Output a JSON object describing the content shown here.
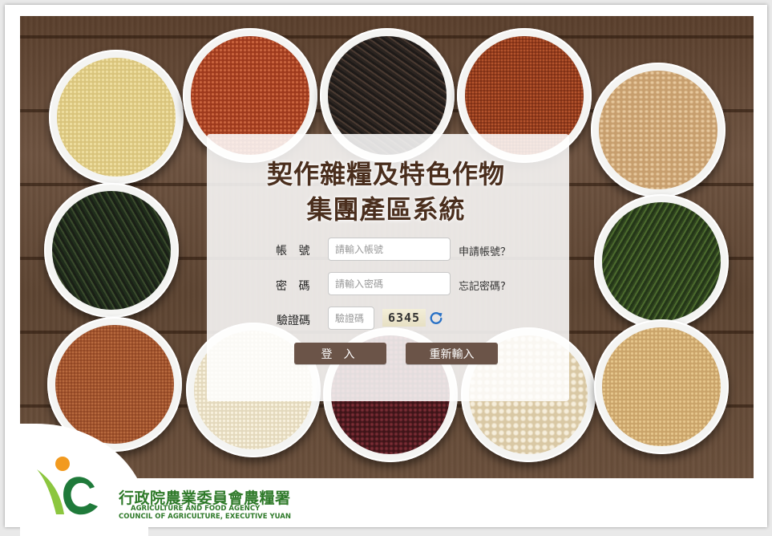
{
  "title": {
    "line1": "契作雜糧及特色作物",
    "line2": "集團產區系統"
  },
  "form": {
    "account_label": "帳 號",
    "account_placeholder": "請輸入帳號",
    "apply_account_link": "申請帳號？",
    "password_label": "密 碼",
    "password_placeholder": "請輸入密碼",
    "forgot_password_link": "忘記密碼?",
    "captcha_label": "驗證碼",
    "captcha_placeholder": "驗證碼",
    "captcha_code": "6345",
    "login_button": "登入",
    "reset_button": "重新輸入"
  },
  "footer": {
    "agency_cn": "行政院農業委員會農糧署",
    "agency_en_line1": "AGRICULTURE AND FOOD AGENCY",
    "agency_en_line2": "COUNCIL OF AGRICULTURE, EXECUTIVE YUAN"
  },
  "colors": {
    "button_bg": "#6b5448",
    "title_text": "#4a2e1d",
    "agency_green": "#2f7a2a",
    "logo_orange": "#f29a1f",
    "refresh_blue": "#2a72c6"
  },
  "icons": {
    "refresh": "refresh-icon",
    "logo": "agency-logo"
  }
}
